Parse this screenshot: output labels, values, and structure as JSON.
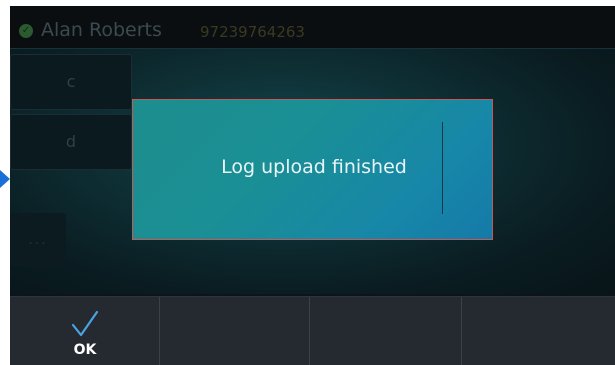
{
  "header": {
    "status_icon": "check-circle-icon",
    "contact_name": "Alan Roberts",
    "contact_number": "97239764263"
  },
  "side_keys": [
    {
      "label": "c"
    },
    {
      "label": "d"
    },
    {
      "label": "..."
    }
  ],
  "dialog": {
    "message": "Log upload finished"
  },
  "softkeys": {
    "ok_label": "OK",
    "ok_icon": "checkmark-icon"
  },
  "colors": {
    "dialog_teal": "#1a8f95",
    "softkey_bg": "#252a30",
    "checkmark": "#4aa3e0",
    "arrow": "#1a6fd6"
  }
}
